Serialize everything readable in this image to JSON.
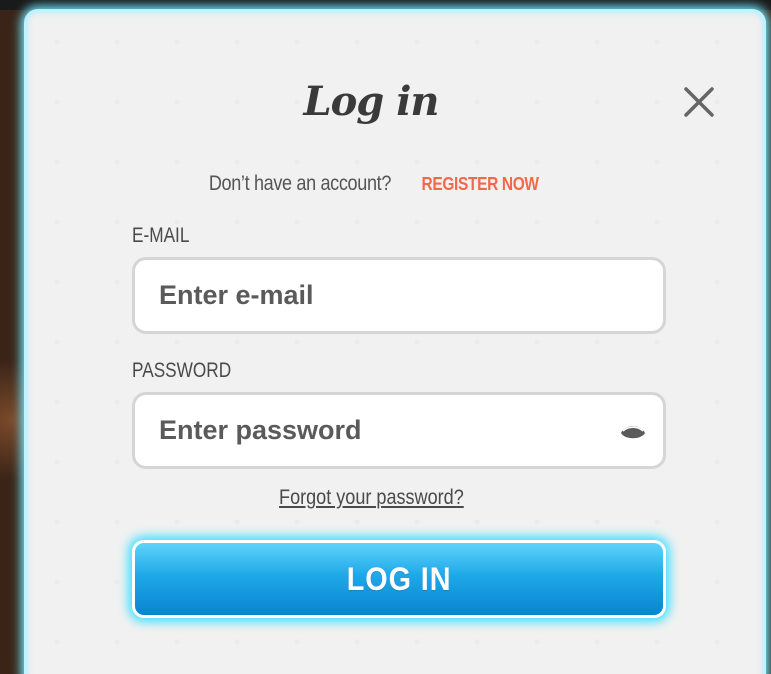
{
  "modal": {
    "title": "Log in",
    "close_icon": "close-icon"
  },
  "register": {
    "prompt": "Don’t have an account?",
    "link_label": "REGISTER NOW",
    "link_color": "#f06a4a"
  },
  "email": {
    "label": "E-MAIL",
    "value": "",
    "placeholder": "Enter e-mail"
  },
  "password": {
    "label": "PASSWORD",
    "value": "",
    "placeholder": "Enter password",
    "toggle_icon": "eye-icon"
  },
  "forgot": {
    "label": "Forgot your password?"
  },
  "login": {
    "label": "LOG IN",
    "accent_color": "#1ea8e8",
    "glow_color": "#42e0ff"
  }
}
